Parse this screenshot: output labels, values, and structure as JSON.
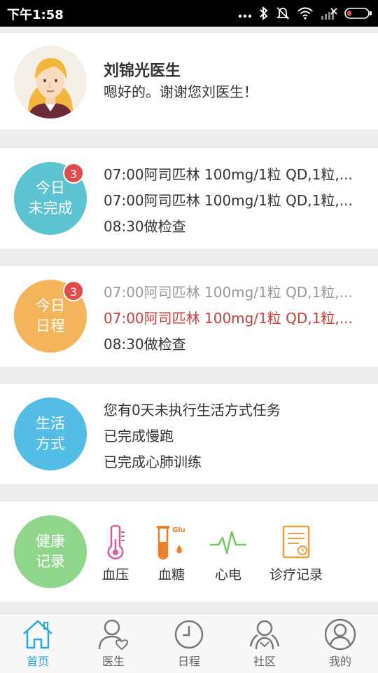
{
  "status_bar": {
    "time": "下午1:58"
  },
  "doctor_message": {
    "name": "刘锦光医生",
    "message": "嗯好的。谢谢您刘医生！"
  },
  "today_incomplete": {
    "label_line1": "今日",
    "label_line2": "未完成",
    "badge_count": "3",
    "color": "#5bc4d0",
    "items": [
      "07:00阿司匹林 100mg/1粒 QD,1粒,...",
      "07:00阿司匹林 100mg/1粒 QD,1粒,...",
      "08:30做检查"
    ]
  },
  "today_schedule": {
    "label_line1": "今日",
    "label_line2": "日程",
    "badge_count": "3",
    "color": "#f4b55a",
    "items": [
      "07:00阿司匹林 100mg/1粒 QD,1粒,...",
      "07:00阿司匹林 100mg/1粒 QD,1粒,...",
      "08:30做检查"
    ],
    "item_colors": [
      "#999999",
      "#d23a3a",
      "#333333"
    ]
  },
  "lifestyle": {
    "label_line1": "生活",
    "label_line2": "方式",
    "color": "#54bde6",
    "items": [
      "您有0天未执行生活方式任务",
      "已完成慢跑",
      "已完成心肺训练"
    ]
  },
  "health_records": {
    "label_line1": "健康",
    "label_line2": "记录",
    "color": "#8fd68a",
    "items": [
      {
        "label": "血压",
        "icon": "thermometer-icon"
      },
      {
        "label": "血糖",
        "icon": "test-tube-icon",
        "icon_text": "Glu"
      },
      {
        "label": "心电",
        "icon": "heartbeat-icon"
      },
      {
        "label": "诊疗记录",
        "icon": "document-icon"
      }
    ]
  },
  "tab_bar": {
    "accent": "#29a9d9",
    "tabs": [
      {
        "label": "首页",
        "icon": "home-icon",
        "active": true
      },
      {
        "label": "医生",
        "icon": "doctor-icon",
        "active": false
      },
      {
        "label": "日程",
        "icon": "clock-icon",
        "active": false
      },
      {
        "label": "社区",
        "icon": "community-icon",
        "active": false
      },
      {
        "label": "我的",
        "icon": "profile-icon",
        "active": false
      }
    ]
  }
}
